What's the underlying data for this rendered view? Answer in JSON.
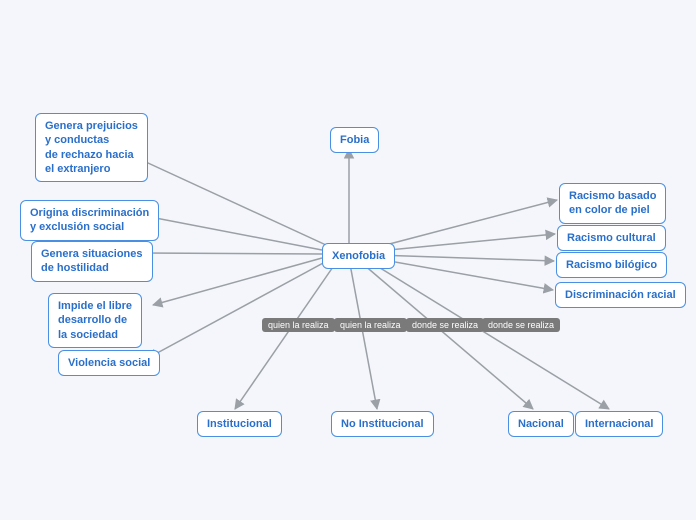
{
  "center": {
    "label": "Xenofobia"
  },
  "nodes": {
    "fobia": "Fobia",
    "prejuicios": "Genera prejuicios\ny conductas\nde rechazo hacia\nel extranjero",
    "discriminacion": "Origina discriminación\ny exclusión social",
    "hostilidad": "Genera situaciones\nde hostilidad",
    "impide": "Impide el libre\ndesarrollo de\nla sociedad",
    "violencia": "Violencia social",
    "institucional": "Institucional",
    "noinstitucional": "No Institucional",
    "nacional": "Nacional",
    "internacional": "Internacional",
    "racismo_piel": "Racismo basado\nen color de piel",
    "racismo_cultural": "Racismo cultural",
    "racismo_bio": "Racismo bilógico",
    "discr_racial": "Discriminación racial"
  },
  "edge_labels": {
    "q1": "quien la realiza",
    "q2": "quien la realiza",
    "d1": "donde se realiza",
    "d2": "donde se realiza"
  },
  "colors": {
    "node_border": "#4a90e2",
    "node_text": "#2a6fc9",
    "edge": "#9aa0a6",
    "label_bg": "#7a7a7a",
    "bg": "#f4f6fb"
  }
}
